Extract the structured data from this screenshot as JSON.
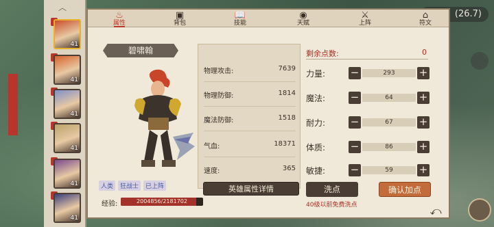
{
  "top_right_value": "(26.7)",
  "tabs": [
    {
      "label": "属性",
      "icon": "flame-icon",
      "glyph": "♨"
    },
    {
      "label": "背包",
      "icon": "backpack-icon",
      "glyph": "▣"
    },
    {
      "label": "技能",
      "icon": "book-icon",
      "glyph": "📖"
    },
    {
      "label": "天赋",
      "icon": "eye-icon",
      "glyph": "◉"
    },
    {
      "label": "上阵",
      "icon": "crossed-swords-icon",
      "glyph": "⚔"
    },
    {
      "label": "符文",
      "icon": "shrine-icon",
      "glyph": "⌂"
    }
  ],
  "hero": {
    "name": "碧啸翰",
    "tags": [
      "人类",
      "狂战士",
      "已上阵"
    ]
  },
  "avatars": [
    {
      "level": "41",
      "color": "#c9502e"
    },
    {
      "level": "41",
      "color": "#d8642e"
    },
    {
      "level": "41",
      "color": "#8090c8"
    },
    {
      "level": "41",
      "color": "#b9a36b"
    },
    {
      "level": "41",
      "color": "#7a4a8c"
    },
    {
      "level": "41",
      "color": "#3c3f7a"
    }
  ],
  "stats": [
    {
      "label": "物理攻击:",
      "value": "7639"
    },
    {
      "label": "物理防御:",
      "value": "1814"
    },
    {
      "label": "魔法防御:",
      "value": "1518"
    },
    {
      "label": "气血:",
      "value": "18371"
    },
    {
      "label": "速度:",
      "value": "365"
    }
  ],
  "detail_button": "英雄属性详情",
  "remaining_points": {
    "label": "剩余点数:",
    "value": "0"
  },
  "attributes": [
    {
      "label": "力量:",
      "value": "293"
    },
    {
      "label": "魔法:",
      "value": "64"
    },
    {
      "label": "耐力:",
      "value": "67"
    },
    {
      "label": "体质:",
      "value": "86"
    },
    {
      "label": "敏捷:",
      "value": "59"
    }
  ],
  "wash_button": "洗点",
  "wash_note": "40级以前免费洗点",
  "confirm_button": "确认加点",
  "exp": {
    "label": "经验:",
    "text": "2004856/2181702",
    "fraction": 0.919
  },
  "colors": {
    "accent": "#b83a2c",
    "panel": "#f0e8d8",
    "dark_button": "#4a3d34",
    "confirm": "#c26b3b"
  }
}
